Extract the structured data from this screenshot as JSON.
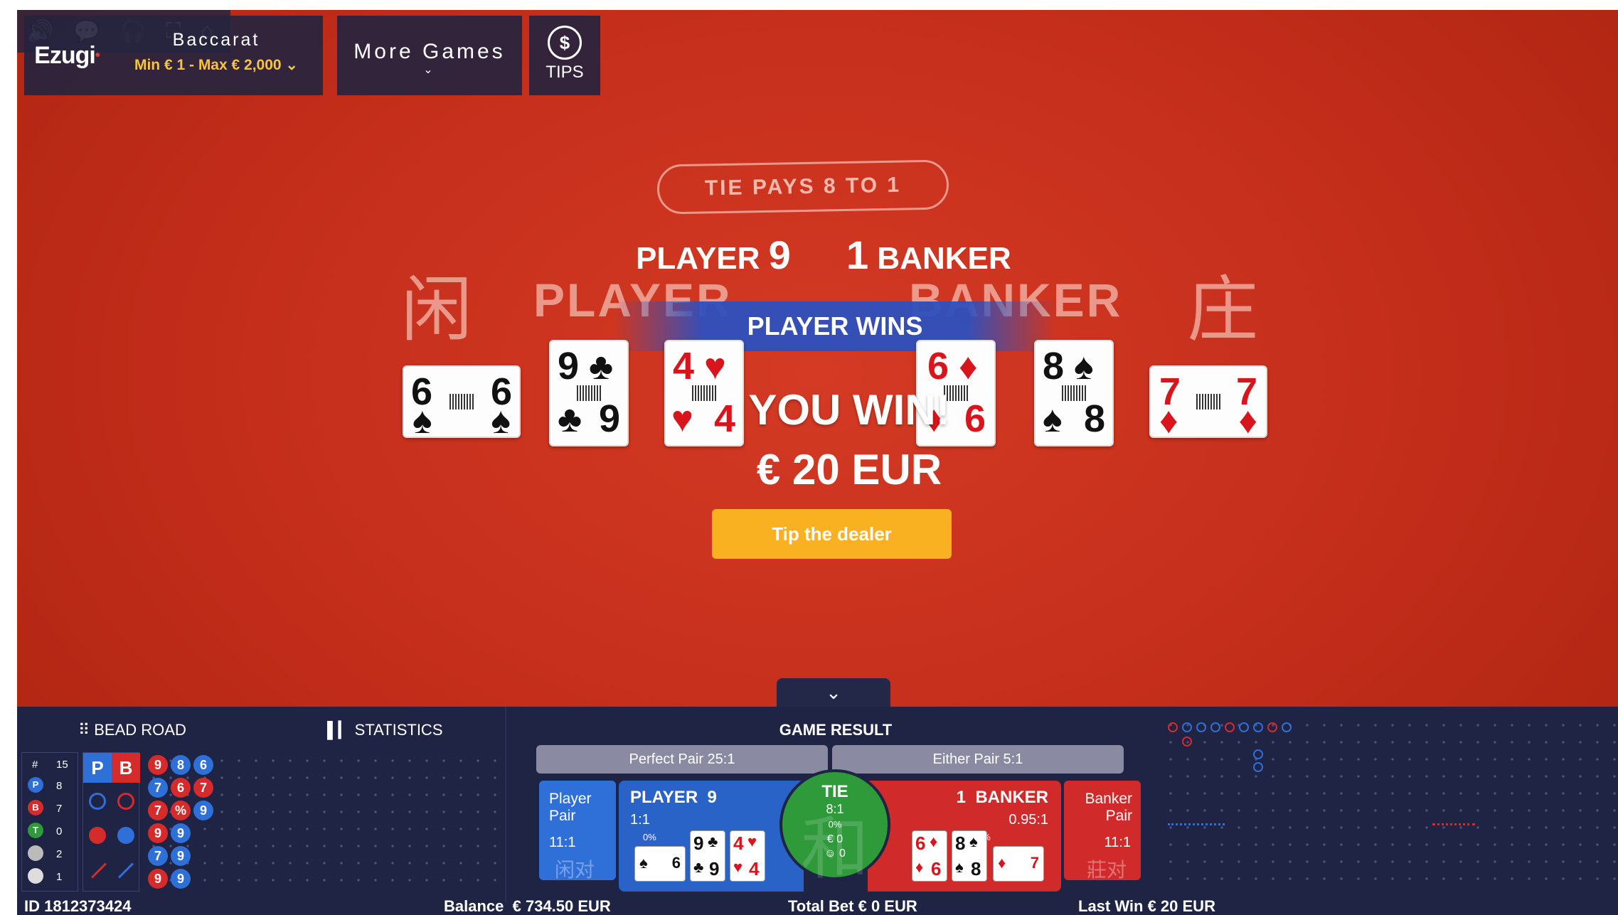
{
  "header": {
    "logo": "Ezugi",
    "table_name": "Baccarat",
    "limits": "Min € 1 - Max € 2,000",
    "more_games": "More Games",
    "tips": "TIPS"
  },
  "tools": [
    "speaker-icon",
    "chat-icon",
    "headset-icon",
    "fullscreen-icon",
    "home-icon"
  ],
  "felt": {
    "tie_pays": "TIE PAYS 8 TO 1",
    "player_label": "PLAYER",
    "banker_label": "BANKER",
    "player_chinese": "闲",
    "banker_chinese": "庄"
  },
  "result": {
    "player_text": "PLAYER",
    "player_score": "9",
    "banker_text": "BANKER",
    "banker_score": "1",
    "wins": "PLAYER WINS",
    "you_win": "YOU WIN!",
    "amount": "€ 20 EUR",
    "tip_button": "Tip the dealer"
  },
  "cards": {
    "player": [
      {
        "rank": "6",
        "suit": "♠"
      },
      {
        "rank": "9",
        "suit": "♣"
      },
      {
        "rank": "4",
        "suit": "♥"
      }
    ],
    "banker": [
      {
        "rank": "6",
        "suit": "♦"
      },
      {
        "rank": "8",
        "suit": "♠"
      },
      {
        "rank": "7",
        "suit": "♦"
      }
    ]
  },
  "panel": {
    "bead_road": "BEAD ROAD",
    "statistics": "STATISTICS",
    "game_result": "GAME RESULT",
    "stats": [
      {
        "k": "#",
        "v": "15"
      },
      {
        "k": "P",
        "v": "8"
      },
      {
        "k": "B",
        "v": "7"
      },
      {
        "k": "T",
        "v": "0"
      },
      {
        "k": "",
        "v": "2"
      },
      {
        "k": "",
        "v": "1"
      }
    ],
    "pb_header": {
      "p": "P",
      "b": "B"
    },
    "bead_cols": [
      [
        "9",
        "7",
        "7",
        "9",
        "7",
        "9"
      ],
      [
        "8",
        "6",
        "%",
        "9",
        "9",
        "9"
      ],
      [
        "6",
        "7",
        "9",
        "",
        "",
        ""
      ]
    ],
    "perfect_pair": "Perfect Pair 25:1",
    "either_pair": "Either Pair 5:1",
    "player_pair": {
      "label": "Player Pair",
      "odds": "11:1",
      "chinese": "闲对"
    },
    "banker_pair": {
      "label": "Banker Pair",
      "odds": "11:1",
      "chinese": "莊对"
    },
    "player_bet": {
      "label": "PLAYER",
      "score": "9",
      "odds": "1:1",
      "pct": "0%"
    },
    "tie_bet": {
      "label": "TIE",
      "odds": "8:1",
      "pct": "0%",
      "amt": "€ 0",
      "count": "0",
      "chinese": "和"
    },
    "banker_bet": {
      "label": "BANKER",
      "score": "1",
      "odds": "0.95:1",
      "pct": "0%"
    }
  },
  "status": {
    "id": "ID 1812373424",
    "balance_label": "Balance",
    "balance": "€ 734.50 EUR",
    "total_bet": "Total Bet € 0 EUR",
    "last_win": "Last Win € 20 EUR"
  },
  "colors": {
    "accent": "#f9b122",
    "player": "#2f6fd8",
    "banker": "#d62b2b",
    "tie": "#2e9a3a",
    "panel": "#1f2344"
  }
}
